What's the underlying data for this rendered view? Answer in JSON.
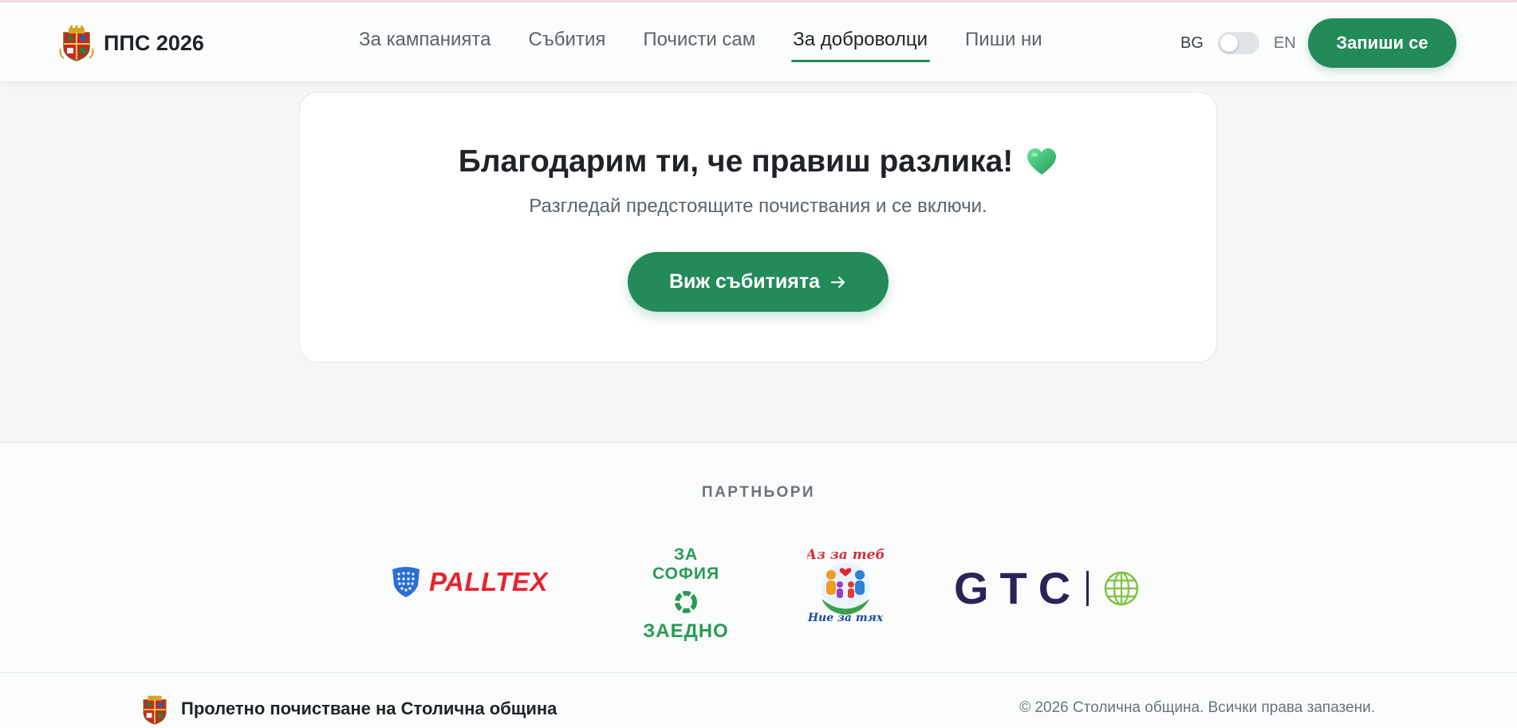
{
  "brand": {
    "title": "ППС 2026"
  },
  "nav": {
    "items": [
      {
        "label": "За кампанията"
      },
      {
        "label": "Събития"
      },
      {
        "label": "Почисти сам"
      },
      {
        "label": "За доброволци"
      },
      {
        "label": "Пиши ни"
      }
    ],
    "active": "За доброволци"
  },
  "language": {
    "bg": "BG",
    "en": "EN",
    "selected": "BG"
  },
  "signup_button": "Запиши се",
  "thanks_card": {
    "heading": "Благодарим ти, че правиш разлика!",
    "subtext": "Разгледай предстоящите почиствания и се включи.",
    "cta": "Виж събитията"
  },
  "partners": {
    "title": "ПАРТНЬОРИ",
    "logos": [
      {
        "name": "PALLTEX"
      },
      {
        "line1": "ЗА СОФИЯ",
        "line2": "ЗАЕДНО"
      },
      {
        "line1": "Аз за теб",
        "line2": "Ние за тях"
      },
      {
        "name": "GTC"
      }
    ]
  },
  "footer": {
    "title": "Пролетно почистване на Столична община",
    "copyright": "© 2026 Столична община. Всички права запазени."
  },
  "colors": {
    "primary": "#238a5a",
    "background": "#f5f7f6",
    "palltex_red": "#e8232f",
    "gtc_navy": "#2a2355"
  }
}
